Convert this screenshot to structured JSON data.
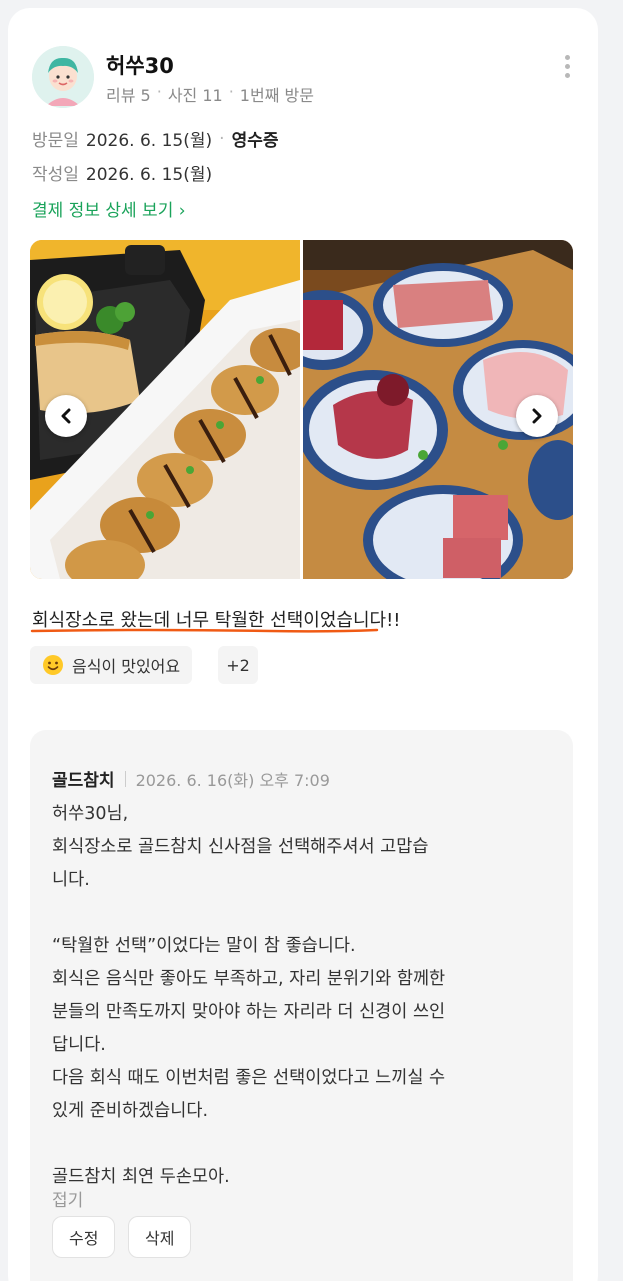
{
  "reviewer": {
    "name": "허쑤30",
    "stats": [
      "리뷰 5",
      "사진 11",
      "1번째 방문"
    ]
  },
  "visit": {
    "visit_label": "방문일",
    "visit_date": "2026. 6. 15(월)",
    "receipt": "영수증",
    "written_label": "작성일",
    "written_date": "2026. 6. 15(월)",
    "payment_link": "결제 정보 상세 보기 ›"
  },
  "review": {
    "text": "회식장소로 왔는데 너무 탁월한 선택이었습니다!!",
    "tag": "음식이 맛있어요",
    "more_tags": "+2"
  },
  "reply": {
    "owner": "골드참치",
    "date": "2026. 6. 16(화) 오후 7:09",
    "lines": [
      "허쑤30님,",
      "회식장소로 골드참치 신사점을 선택해주셔서 고맙습",
      "니다.",
      "",
      "“탁월한 선택”이었다는 말이 참 좋습니다.",
      "회식은 음식만 좋아도 부족하고, 자리 분위기와 함께한",
      "분들의 만족도까지 맞아야 하는 자리라 더 신경이 쓰인",
      "답니다.",
      "다음 회식 때도 이번처럼 좋은 선택이었다고 느끼실 수",
      "있게 준비하겠습니다.",
      "",
      "골드참치 최연 두손모아."
    ],
    "fold": "접기",
    "edit": "수정",
    "delete": "삭제"
  },
  "colors": {
    "link_green": "#1aa35a",
    "underline_orange": "#f05a14"
  }
}
